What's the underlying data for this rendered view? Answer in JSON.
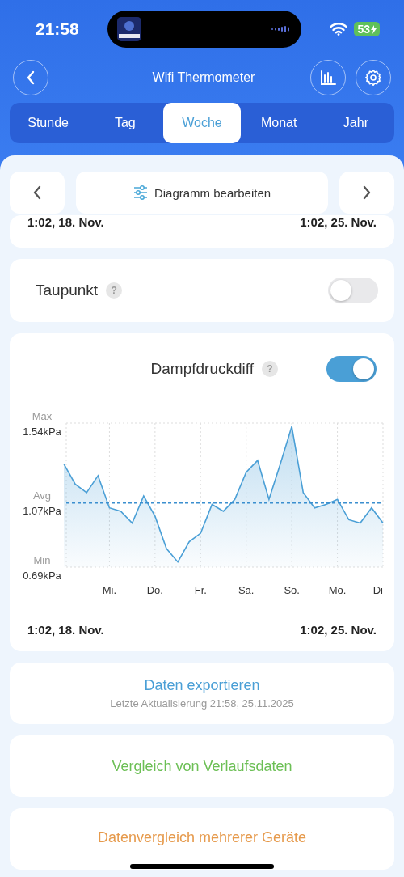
{
  "status_bar": {
    "time": "21:58",
    "battery": "53"
  },
  "header": {
    "title": "Wifi Thermometer"
  },
  "tabs": [
    {
      "label": "Stunde",
      "selected": false
    },
    {
      "label": "Tag",
      "selected": false
    },
    {
      "label": "Woche",
      "selected": true
    },
    {
      "label": "Monat",
      "selected": false
    },
    {
      "label": "Jahr",
      "selected": false
    }
  ],
  "edit_button": {
    "label": "Diagramm bearbeiten"
  },
  "previous_card": {
    "start": "1:02,  18. Nov.",
    "end": "1:02,  25. Nov."
  },
  "dew_point": {
    "label": "Taupunkt",
    "help": "?",
    "on": false
  },
  "vpd_card": {
    "help": "?",
    "on": true,
    "tick_names": [
      "Max",
      "Avg",
      "Min"
    ],
    "chart_data": {
      "type": "area",
      "grid": true,
      "ref_lines": [
        {
          "axis": "y",
          "value": 1.07,
          "color": "#3b8fcf"
        }
      ],
      "ylim": [
        0.69,
        1.54
      ],
      "yticks": [
        {
          "value": 0.69,
          "label": "0.69kPa"
        },
        {
          "value": 1.07,
          "label": "1.07kPa"
        },
        {
          "value": 1.54,
          "label": "1.54kPa"
        }
      ],
      "categories": [
        null,
        null,
        null,
        null,
        "Mi.",
        null,
        null,
        null,
        "Do.",
        null,
        null,
        null,
        "Fr.",
        null,
        null,
        null,
        "Sa.",
        null,
        null,
        null,
        "So.",
        null,
        null,
        null,
        "Mo.",
        null,
        null,
        null,
        "Di"
      ],
      "series": [
        {
          "name": "Dampfdruckdiff",
          "color": "#4a9fd6",
          "values": [
            1.3,
            1.18,
            1.13,
            1.23,
            1.04,
            1.02,
            0.95,
            1.11,
            0.99,
            0.8,
            0.72,
            0.84,
            0.89,
            1.06,
            1.02,
            1.09,
            1.25,
            1.32,
            1.09,
            1.3,
            1.52,
            1.13,
            1.04,
            1.06,
            1.09,
            0.97,
            0.95,
            1.04,
            0.95
          ]
        }
      ]
    },
    "start": "1:02,  18. Nov.",
    "end": "1:02,  25. Nov."
  },
  "export": {
    "label": "Daten exportieren",
    "updated": "Letzte Aktualisierung 21:58,  25.11.2025"
  },
  "actions": [
    {
      "label": "Vergleich von Verlaufsdaten",
      "color": "#6cbf55"
    },
    {
      "label": "Datenvergleich mehrerer Geräte",
      "color": "#e69a4c"
    }
  ]
}
